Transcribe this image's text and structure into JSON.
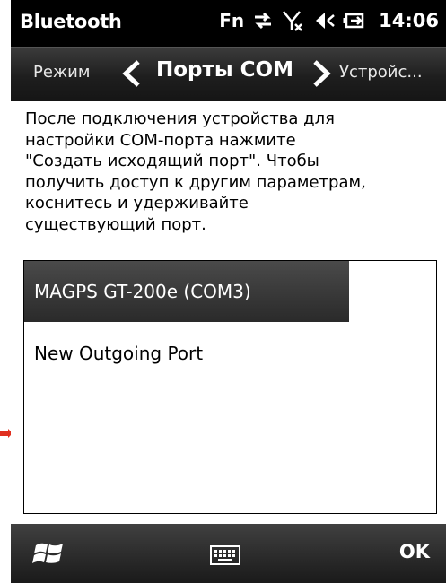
{
  "status_bar": {
    "app_title": "Bluetooth",
    "fn_label": "Fn",
    "time": "14:06"
  },
  "nav": {
    "left_label": "Режим",
    "title": "Порты COM",
    "right_label": "Устройс..."
  },
  "content": {
    "instructions": "После подключения устройства для\nнастройки COM-порта нажмите\n\"Создать исходящий порт\". Чтобы\nполучить доступ к другим параметрам,\nкоснитесь и удерживайте\nсуществующий порт."
  },
  "ports": [
    {
      "label": "MAGPS GT-200e (COM3)",
      "selected": true
    },
    {
      "label": "New Outgoing Port",
      "selected": false
    }
  ],
  "soft_bar": {
    "ok_label": "OK"
  },
  "colors": {
    "accent_arrow": "#e03020",
    "selected_row": "#353535"
  },
  "icons": [
    "sync-icon",
    "signal-off-icon",
    "speaker-icon",
    "battery-icon",
    "windows-start-icon",
    "keyboard-icon",
    "chevron-left-icon",
    "chevron-right-icon"
  ]
}
